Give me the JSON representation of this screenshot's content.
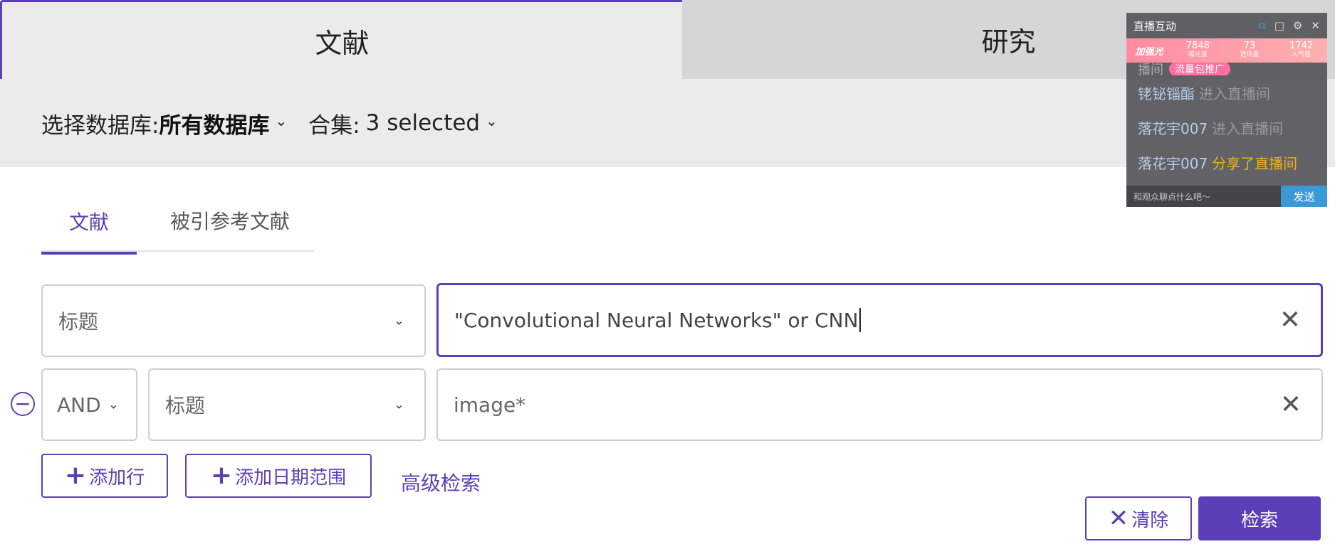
{
  "top_tabs": {
    "left": "文献",
    "right": "研究"
  },
  "db_bar": {
    "db_label": "选择数据库:",
    "db_value": "所有数据库",
    "collection_label": "合集:",
    "collection_value": "3 selected"
  },
  "sub_tabs": {
    "active": "文献",
    "cited": "被引参考文献"
  },
  "row1": {
    "field": "标题",
    "query": "\"Convolutional Neural Networks\" or CNN"
  },
  "row2": {
    "operator": "AND",
    "field": "标题",
    "query": "image*"
  },
  "actions": {
    "add_row": "添加行",
    "add_date": "添加日期范围",
    "advanced": "高级检索",
    "clear": "清除",
    "search": "检索"
  },
  "live": {
    "title": "直播互动",
    "brand": "加强光",
    "stats": [
      {
        "value": "7848",
        "label": "曝光量"
      },
      {
        "value": "73",
        "label": "进场量"
      },
      {
        "value": "1742",
        "label": "人气值"
      }
    ],
    "partial_text": "播间",
    "partial_pill": "流量包推广",
    "messages": [
      {
        "user": "铑铋锱酯",
        "action": "进入直播间",
        "type": "enter"
      },
      {
        "user": "落花宇007",
        "action": "进入直播间",
        "type": "enter"
      },
      {
        "user": "落花宇007",
        "action": "分享了直播间",
        "type": "share"
      }
    ],
    "input_placeholder": "和观众聊点什么吧～",
    "send": "发送"
  }
}
